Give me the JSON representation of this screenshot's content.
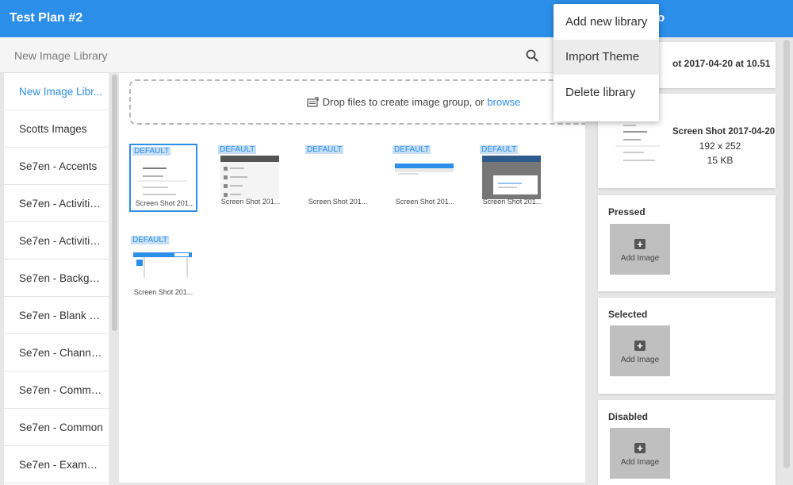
{
  "header": {
    "title": "Test Plan #2",
    "right_title_fragment": "o"
  },
  "search": {
    "placeholder": "New Image Library"
  },
  "sidebar": {
    "items": [
      {
        "label": "New Image Libr..."
      },
      {
        "label": "Scotts Images"
      },
      {
        "label": "Se7en - Accents"
      },
      {
        "label": "Se7en - Activities..."
      },
      {
        "label": "Se7en - Activities..."
      },
      {
        "label": "Se7en - Backgro..."
      },
      {
        "label": "Se7en - Blank B..."
      },
      {
        "label": "Se7en - Channels"
      },
      {
        "label": "Se7en - Comme..."
      },
      {
        "label": "Se7en - Common"
      },
      {
        "label": "Se7en - Examples"
      }
    ]
  },
  "dropzone": {
    "text": "Drop files to create image group, or",
    "link": "browse"
  },
  "images": [
    {
      "tag": "DEFAULT",
      "caption": "Screen Shot 201..."
    },
    {
      "tag": "DEFAULT",
      "caption": "Screen Shot 201..."
    },
    {
      "tag": "DEFAULT",
      "caption": "Screen Shot 201..."
    },
    {
      "tag": "DEFAULT",
      "caption": "Screen Shot 201..."
    },
    {
      "tag": "DEFAULT",
      "caption": "Screen Shot 201..."
    },
    {
      "tag": "DEFAULT",
      "caption": "Screen Shot 201..."
    }
  ],
  "details": {
    "name_fragment": "ot 2017-04-20 at 10.51",
    "info_name": "Screen Shot 2017-04-20",
    "dimensions": "192 x 252",
    "size": "15 KB"
  },
  "states": [
    {
      "label": "Pressed",
      "add": "Add Image"
    },
    {
      "label": "Selected",
      "add": "Add Image"
    },
    {
      "label": "Disabled",
      "add": "Add Image"
    }
  ],
  "menu": {
    "items": [
      {
        "label": "Add new library"
      },
      {
        "label": "Import Theme"
      },
      {
        "label": "Delete library"
      }
    ]
  },
  "colors": {
    "accent": "#2b8ee8",
    "tag_bg": "#c7dff5",
    "tile_bg": "#bfbfbf"
  }
}
